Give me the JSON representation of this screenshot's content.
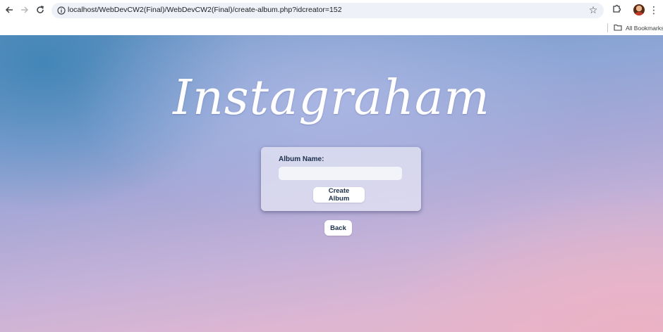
{
  "browser": {
    "url": "localhost/WebDevCW2(Final)/WebDevCW2(Final)/create-album.php?idcreator=152",
    "icons": {
      "back": "arrow-left-icon",
      "forward": "arrow-right-icon",
      "reload": "reload-icon",
      "site_info": "tune-icon",
      "bookmark_star": "star-icon",
      "extensions": "puzzle-icon",
      "profile": "avatar",
      "menu": "kebab-menu-icon",
      "folder": "folder-icon"
    },
    "bookmarks_bar": {
      "all_bookmarks_label": "All Bookmarks"
    }
  },
  "page": {
    "logo_text": "Instagraham",
    "form": {
      "album_name_label": "Album Name:",
      "album_name_value": "",
      "create_button_label": "Create Album"
    },
    "back_button_label": "Back",
    "colors": {
      "card_text": "#1c2f4b",
      "button_bg": "#ffffff",
      "logo": "#ffffff"
    }
  }
}
